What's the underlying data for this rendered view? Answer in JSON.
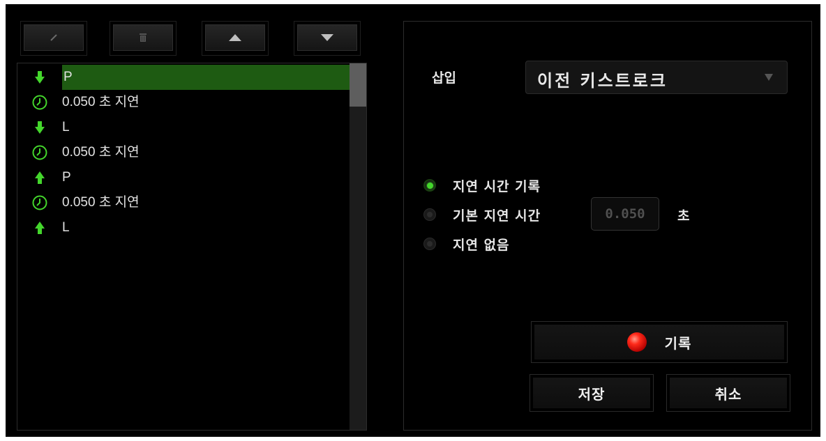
{
  "colors": {
    "accent": "#44d62c",
    "selected_row": "#1e5b12",
    "background": "#000000",
    "record": "#e01a0a"
  },
  "toolbar": {
    "buttons": [
      {
        "name": "edit",
        "icon": "pencil-icon"
      },
      {
        "name": "delete",
        "icon": "trash-icon"
      },
      {
        "name": "move-up",
        "icon": "triangle-up-icon"
      },
      {
        "name": "move-down",
        "icon": "triangle-down-icon"
      }
    ]
  },
  "macro_list": {
    "items": [
      {
        "icon": "arrow-down-icon",
        "text": "P",
        "selected": true
      },
      {
        "icon": "clock-icon",
        "text": "0.050 초 지연"
      },
      {
        "icon": "arrow-down-icon",
        "text": "L"
      },
      {
        "icon": "clock-icon",
        "text": "0.050 초 지연"
      },
      {
        "icon": "arrow-up-icon",
        "text": "P"
      },
      {
        "icon": "clock-icon",
        "text": "0.050 초 지연"
      },
      {
        "icon": "arrow-up-icon",
        "text": "L"
      }
    ]
  },
  "settings": {
    "insert_label": "삽입",
    "insert_value": "이전 키스트로크",
    "delay_options": [
      {
        "label": "지연 시간 기록",
        "selected": true
      },
      {
        "label": "기본 지연 시간",
        "selected": false
      },
      {
        "label": "지연 없음",
        "selected": false
      }
    ],
    "default_delay_value": "0.050",
    "delay_unit": "초",
    "record_label": "기록",
    "save_label": "저장",
    "cancel_label": "취소"
  }
}
